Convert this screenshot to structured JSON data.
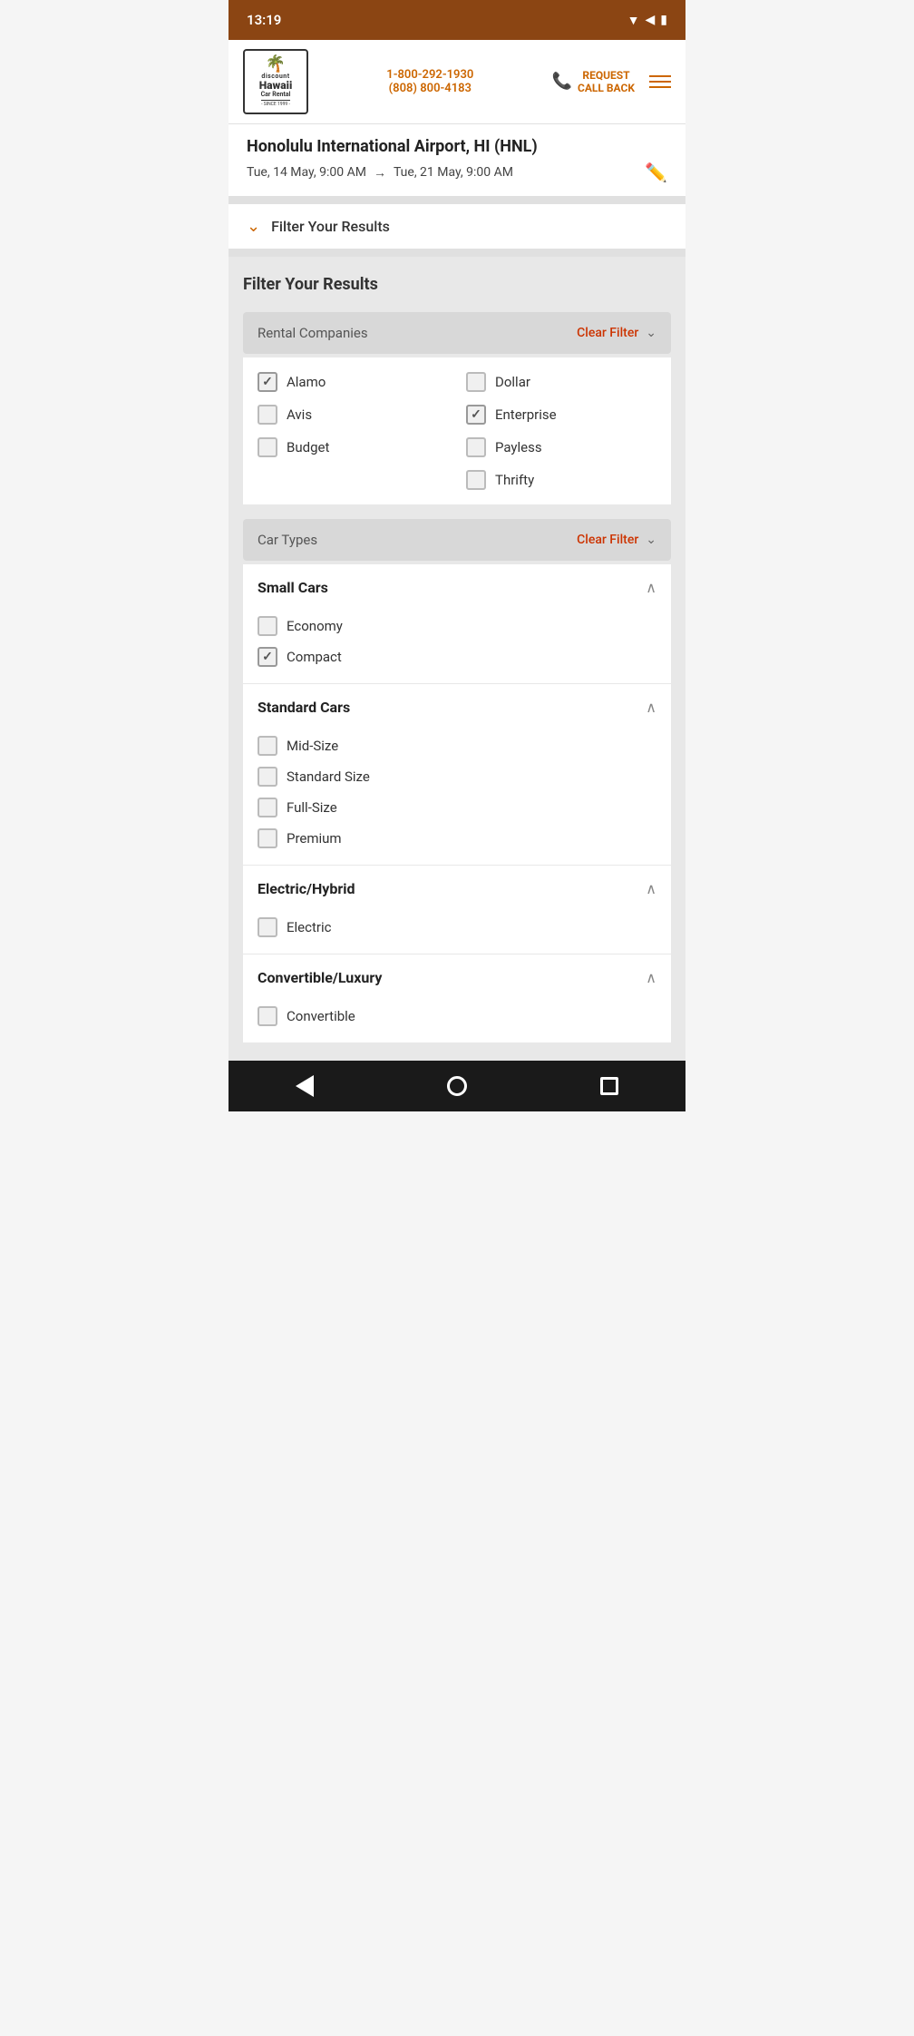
{
  "statusBar": {
    "time": "13:19",
    "icons": [
      "wifi",
      "signal",
      "battery"
    ]
  },
  "header": {
    "logo": {
      "discount": "discount",
      "hawaii": "Hawaii",
      "car": "Car Rental",
      "since": "- SINCE 1999 -"
    },
    "phone1": "1-800-292-1930",
    "phone2": "(808) 800-4183",
    "requestCallback": "REQUEST\nCALL BACK"
  },
  "search": {
    "location": "Honolulu International Airport, HI (HNL)",
    "dateFrom": "Tue, 14 May,  9:00 AM",
    "dateTo": "Tue, 21 May,  9:00 AM"
  },
  "filterToggle": {
    "label": "Filter Your Results"
  },
  "filterPanel": {
    "title": "Filter Your Results",
    "rentalCompanies": {
      "label": "Rental Companies",
      "clearFilter": "Clear Filter",
      "companies": [
        {
          "name": "Alamo",
          "checked": true
        },
        {
          "name": "Dollar",
          "checked": false
        },
        {
          "name": "Avis",
          "checked": false
        },
        {
          "name": "Enterprise",
          "checked": true
        },
        {
          "name": "Budget",
          "checked": false
        },
        {
          "name": "Payless",
          "checked": false
        },
        {
          "name": "Thrifty",
          "checked": false
        }
      ]
    },
    "carTypes": {
      "label": "Car Types",
      "clearFilter": "Clear Filter",
      "groups": [
        {
          "title": "Small Cars",
          "expanded": true,
          "items": [
            {
              "name": "Economy",
              "checked": false
            },
            {
              "name": "Compact",
              "checked": true
            }
          ]
        },
        {
          "title": "Standard Cars",
          "expanded": true,
          "items": [
            {
              "name": "Mid-Size",
              "checked": false
            },
            {
              "name": "Standard Size",
              "checked": false
            },
            {
              "name": "Full-Size",
              "checked": false
            },
            {
              "name": "Premium",
              "checked": false
            }
          ]
        },
        {
          "title": "Electric/Hybrid",
          "expanded": true,
          "items": [
            {
              "name": "Electric",
              "checked": false
            }
          ]
        },
        {
          "title": "Convertible/Luxury",
          "expanded": true,
          "items": [
            {
              "name": "Convertible",
              "checked": false
            }
          ]
        }
      ]
    }
  },
  "bottomNav": {
    "back": "back",
    "home": "home",
    "recents": "recents"
  }
}
